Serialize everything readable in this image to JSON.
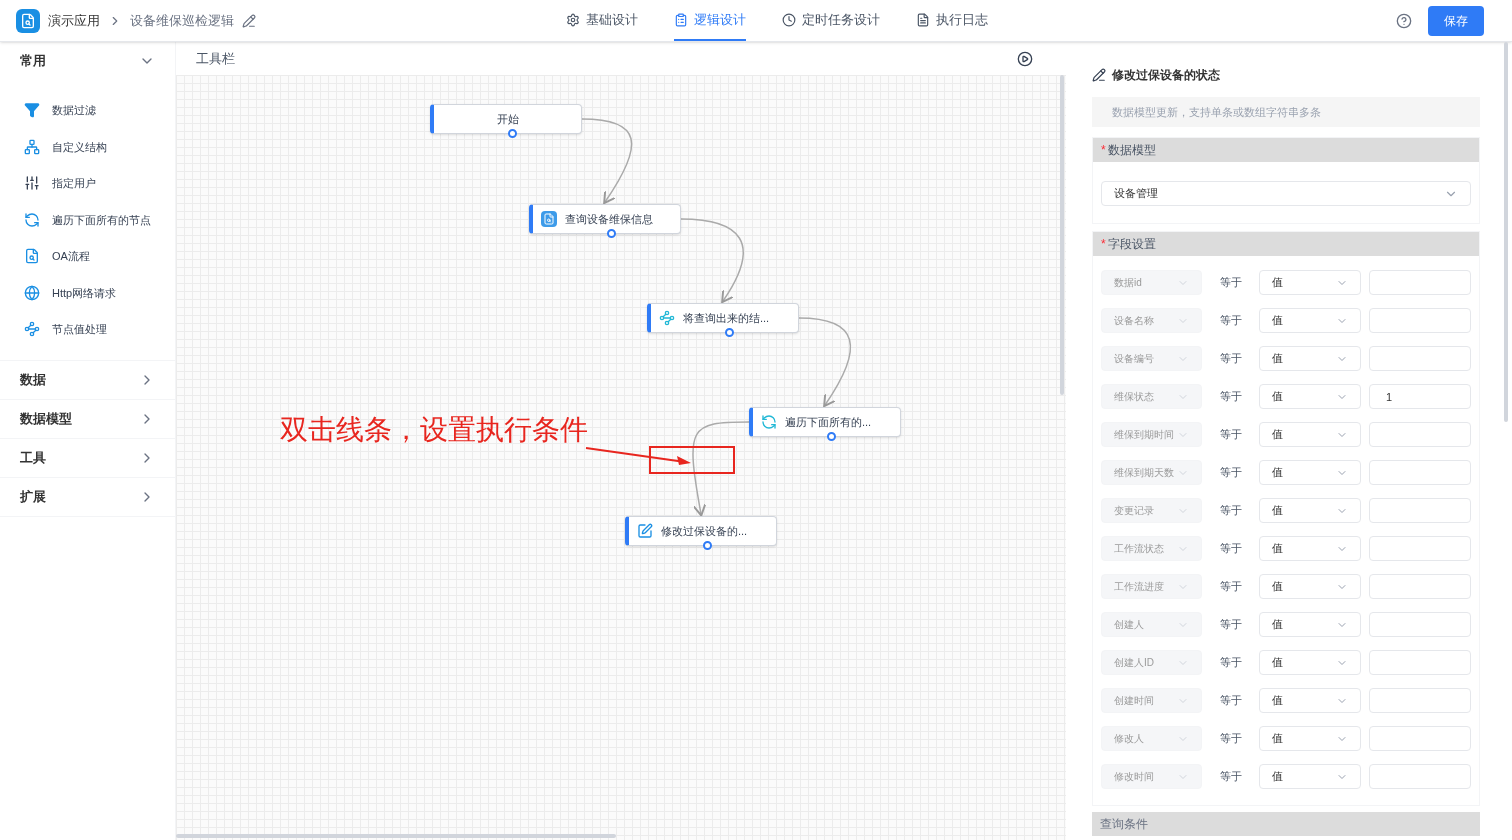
{
  "header": {
    "app_name": "演示应用",
    "page_title": "设备维保巡检逻辑",
    "tabs": [
      {
        "label": "基础设计",
        "kind": "gear",
        "selected": false
      },
      {
        "label": "逻辑设计",
        "kind": "logic",
        "selected": true
      },
      {
        "label": "定时任务设计",
        "kind": "clock",
        "selected": false
      },
      {
        "label": "执行日志",
        "kind": "doc",
        "selected": false
      }
    ],
    "save": "保存"
  },
  "sidebar": [
    {
      "title": "常用",
      "expanded": true,
      "items": [
        {
          "label": "数据过滤",
          "kind": "filter"
        },
        {
          "label": "自定义结构",
          "kind": "struct"
        },
        {
          "label": "指定用户",
          "kind": "user"
        },
        {
          "label": "遍历下面所有的节点",
          "kind": "loop"
        },
        {
          "label": "OA流程",
          "kind": "oa"
        },
        {
          "label": "Http网络请求",
          "kind": "http"
        },
        {
          "label": "节点值处理",
          "kind": "transform"
        }
      ]
    },
    {
      "title": "数据",
      "expanded": false
    },
    {
      "title": "数据模型",
      "expanded": false
    },
    {
      "title": "工具",
      "expanded": false
    },
    {
      "title": "扩展",
      "expanded": false
    }
  ],
  "canvas": {
    "toolbar_label": "工具栏",
    "nodes": [
      {
        "label": "开始",
        "kind": "start"
      },
      {
        "label": "查询设备维保信息",
        "kind": "query"
      },
      {
        "label": "将查询出来的结...",
        "kind": "transform"
      },
      {
        "label": "遍历下面所有的...",
        "kind": "loop"
      },
      {
        "label": "修改过保设备的...",
        "kind": "update"
      }
    ],
    "annotation": "双击线条，设置执行条件"
  },
  "panel": {
    "title": "修改过保设备的状态",
    "description": "数据模型更新，支持单条或数组字符串多条",
    "model_section": {
      "label": "数据模型",
      "required_mark": "*",
      "value": "设备管理"
    },
    "field_section": {
      "label": "字段设置",
      "required_mark": "*",
      "rows": [
        {
          "field": "数据id",
          "disabled": true,
          "operator": "等于",
          "mode": "值"
        },
        {
          "field": "设备名称",
          "disabled": true,
          "operator": "等于",
          "mode": "值"
        },
        {
          "field": "设备编号",
          "disabled": true,
          "operator": "等于",
          "mode": "值"
        },
        {
          "field": "维保状态",
          "disabled": true,
          "operator": "等于",
          "mode": "值",
          "value": "1"
        },
        {
          "field": "维保到期时间",
          "disabled": true,
          "operator": "等于",
          "mode": "值"
        },
        {
          "field": "维保到期天数",
          "disabled": true,
          "operator": "等于",
          "mode": "值"
        },
        {
          "field": "变更记录",
          "disabled": true,
          "operator": "等于",
          "mode": "值"
        },
        {
          "field": "工作流状态",
          "disabled": true,
          "operator": "等于",
          "mode": "值"
        },
        {
          "field": "工作流进度",
          "disabled": true,
          "operator": "等于",
          "mode": "值"
        },
        {
          "field": "创建人",
          "disabled": true,
          "operator": "等于",
          "mode": "值"
        },
        {
          "field": "创建人ID",
          "disabled": true,
          "operator": "等于",
          "mode": "值"
        },
        {
          "field": "创建时间",
          "disabled": true,
          "operator": "等于",
          "mode": "值"
        },
        {
          "field": "修改人",
          "disabled": true,
          "operator": "等于",
          "mode": "值"
        },
        {
          "field": "修改时间",
          "disabled": true,
          "operator": "等于",
          "mode": "值"
        }
      ]
    },
    "query_section": {
      "label": "查询条件"
    }
  }
}
